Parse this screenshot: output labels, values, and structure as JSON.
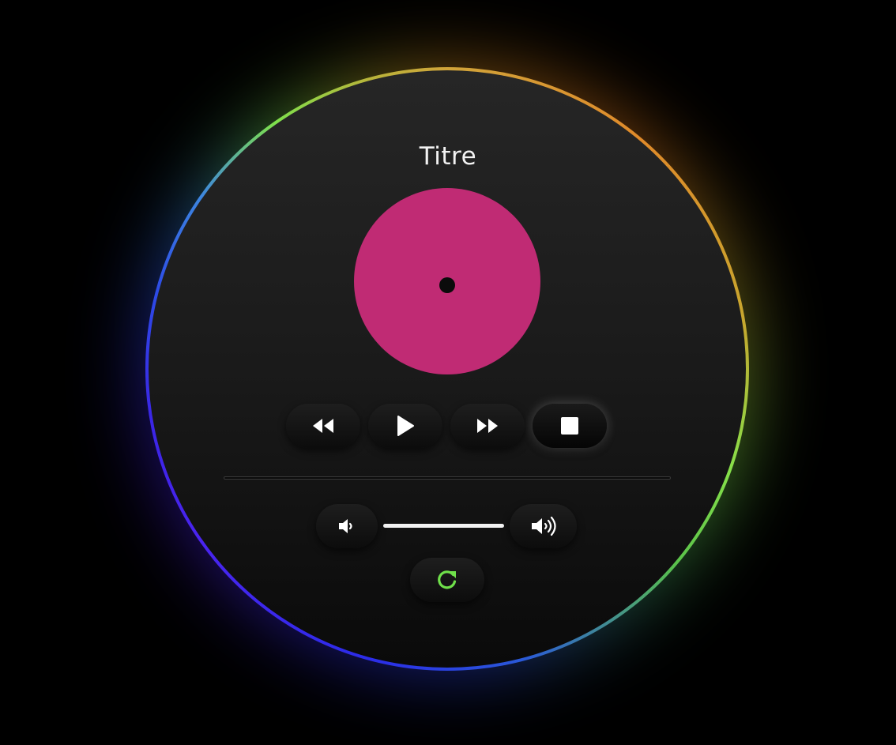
{
  "player": {
    "title": "Titre",
    "disc_color": "#c02b74",
    "progress": 0,
    "volume": 1.0
  },
  "controls": {
    "rewind": "rewind-icon",
    "play": "play-icon",
    "forward": "fast-forward-icon",
    "stop": "stop-icon",
    "volume_down": "volume-down-icon",
    "volume_up": "volume-up-icon",
    "repeat": "repeat-icon"
  },
  "colors": {
    "icon": "#ffffff",
    "repeat_icon": "#6fe04a",
    "background": "#000000"
  }
}
